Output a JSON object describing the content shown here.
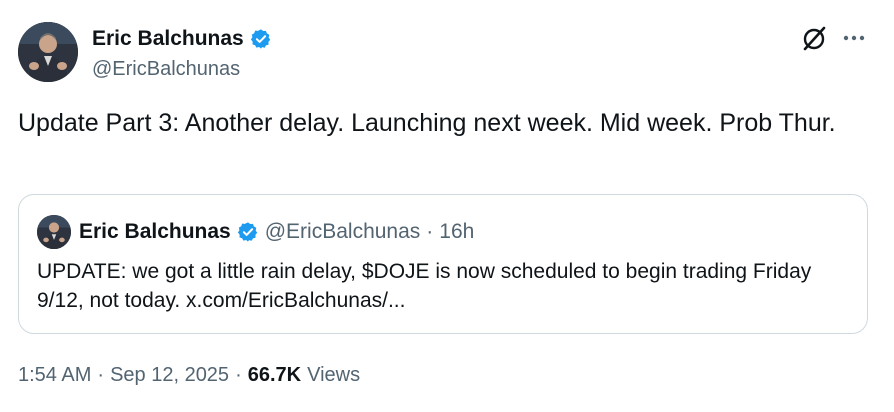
{
  "author": {
    "display_name": "Eric Balchunas",
    "handle": "@EricBalchunas"
  },
  "tweet": {
    "text": "Update Part 3: Another delay. Launching next week. Mid week. Prob Thur."
  },
  "quoted_tweet": {
    "display_name": "Eric Balchunas",
    "handle": "@EricBalchunas",
    "separator": "·",
    "time": "16h",
    "text": "UPDATE: we got a little rain delay, $DOJE is now scheduled to begin trading Friday 9/12, not today. x.com/EricBalchunas/..."
  },
  "meta": {
    "time": "1:54 AM",
    "separator1": "·",
    "date": "Sep 12, 2025",
    "separator2": "·",
    "views_count": "66.7K",
    "views_label": "Views"
  },
  "icons": {
    "verified": "verified-badge-icon",
    "grok": "grok-icon",
    "more": "more-icon"
  },
  "colors": {
    "verified_blue": "#1d9bf0",
    "text_primary": "#0f1419",
    "text_secondary": "#536471",
    "border": "#cfd9de"
  }
}
